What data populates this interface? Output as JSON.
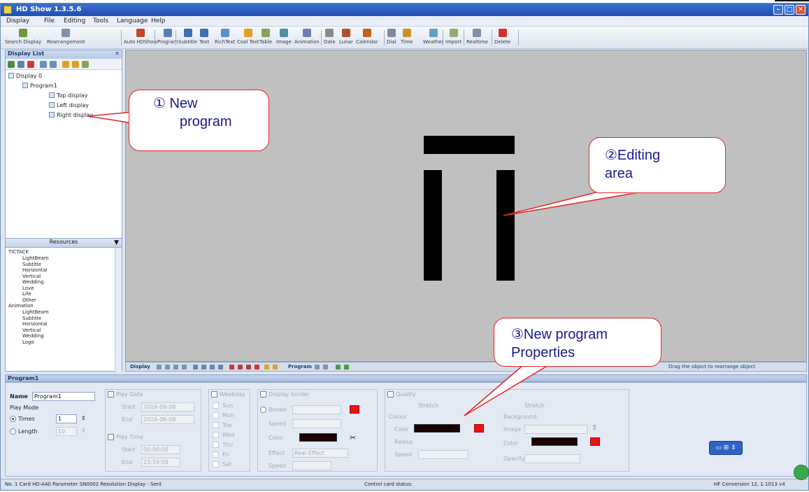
{
  "window": {
    "title": "HD Show 1.3.5.6"
  },
  "menu": [
    "Display",
    "File",
    "Editing",
    "Tools",
    "Language",
    "Help"
  ],
  "toolbar": [
    {
      "label": "Search Display",
      "color": "#6a9a3a"
    },
    {
      "label": "Rearrangement",
      "color": "#7f8fa8"
    },
    {
      "label": "Auto HDShow",
      "color": "#c2472a"
    },
    {
      "label": "Program",
      "color": "#5a7fb8"
    },
    {
      "label": "Subtitle",
      "color": "#3f6db5"
    },
    {
      "label": "Text",
      "color": "#3f6db5"
    },
    {
      "label": "RichText",
      "color": "#5a8fd0"
    },
    {
      "label": "Cool Text",
      "color": "#e0a020"
    },
    {
      "label": "Table",
      "color": "#8a9f5a"
    },
    {
      "label": "Image",
      "color": "#4f8f9f"
    },
    {
      "label": "Animation",
      "color": "#6f7faf"
    },
    {
      "label": "Date",
      "color": "#8a8a8a"
    },
    {
      "label": "Lunar",
      "color": "#b05030"
    },
    {
      "label": "Calendar",
      "color": "#c06020"
    },
    {
      "label": "Dial",
      "color": "#7a8aa0"
    },
    {
      "label": "Time",
      "color": "#d09020"
    },
    {
      "label": "Weather",
      "color": "#60a0c0"
    },
    {
      "label": "Import",
      "color": "#8faf6f"
    },
    {
      "label": "Realtime",
      "color": "#7f8fa8"
    },
    {
      "label": "Delete",
      "color": "#d03030"
    }
  ],
  "left_panel": {
    "header": "Display List",
    "tree": {
      "root": "Display 0",
      "program": "Program1",
      "areas": [
        "Top display",
        "Left display",
        "Right display"
      ]
    }
  },
  "resources": {
    "header": "Resources",
    "groups": [
      {
        "name": "TICTACK",
        "items": [
          "LightBeam",
          "Subtitle",
          "Horizontal",
          "Vertical",
          "Wedding",
          "Love",
          "Life",
          "Other"
        ]
      },
      {
        "name": "Animation",
        "items": [
          "LightBeam",
          "Subtitle",
          "Horizontal",
          "Vertical",
          "Wedding",
          "Logo"
        ]
      }
    ]
  },
  "control_bar": {
    "display_label": "Display",
    "program_label": "Program",
    "hint": "Drag the object to rearrange object"
  },
  "props": {
    "header": "Program1",
    "name_label": "Name",
    "name_value": "Program1",
    "play_mode_label": "Play Mode",
    "times_label": "Times",
    "times_value": "1",
    "length_label": "Length",
    "length_value": "10",
    "play_date_label": "Play Date",
    "start_label": "Start",
    "start_date": "2016-06-08",
    "end_label": "End",
    "end_date": "2016-06-08",
    "play_time_label": "Play Time",
    "time_start": "00:00:00",
    "time_end": "23:59:59",
    "weekday_label": "Weekday",
    "weekdays": [
      "Sun",
      "Mon",
      "Tue",
      "Wed",
      "Thu",
      "Fri",
      "Sat"
    ],
    "display_border_label": "Display border",
    "border_label": "Border",
    "speed_label": "Speed",
    "effect_label": "Effect",
    "effect_value": "Real Effect",
    "quality_label": "Quality",
    "bgcolor_label": "Colour",
    "radio_label": "Radius",
    "bgimage_label": "Background",
    "color_label": "Color",
    "image_label": "Image",
    "opacity_label": "Opacity",
    "status_mode": "Stretch"
  },
  "status_bar": {
    "left": "No. 1 Card HD-A40 Parameter SN0002 Resolution Display - Sent",
    "center": "Control card status:",
    "right": "HF Conversion 12, 1.1013 v4"
  },
  "callouts": [
    {
      "line1": "① New",
      "line2": "program"
    },
    {
      "line1": "②Editing",
      "line2": "area"
    },
    {
      "line1": "③New program",
      "line2": "Properties"
    }
  ]
}
